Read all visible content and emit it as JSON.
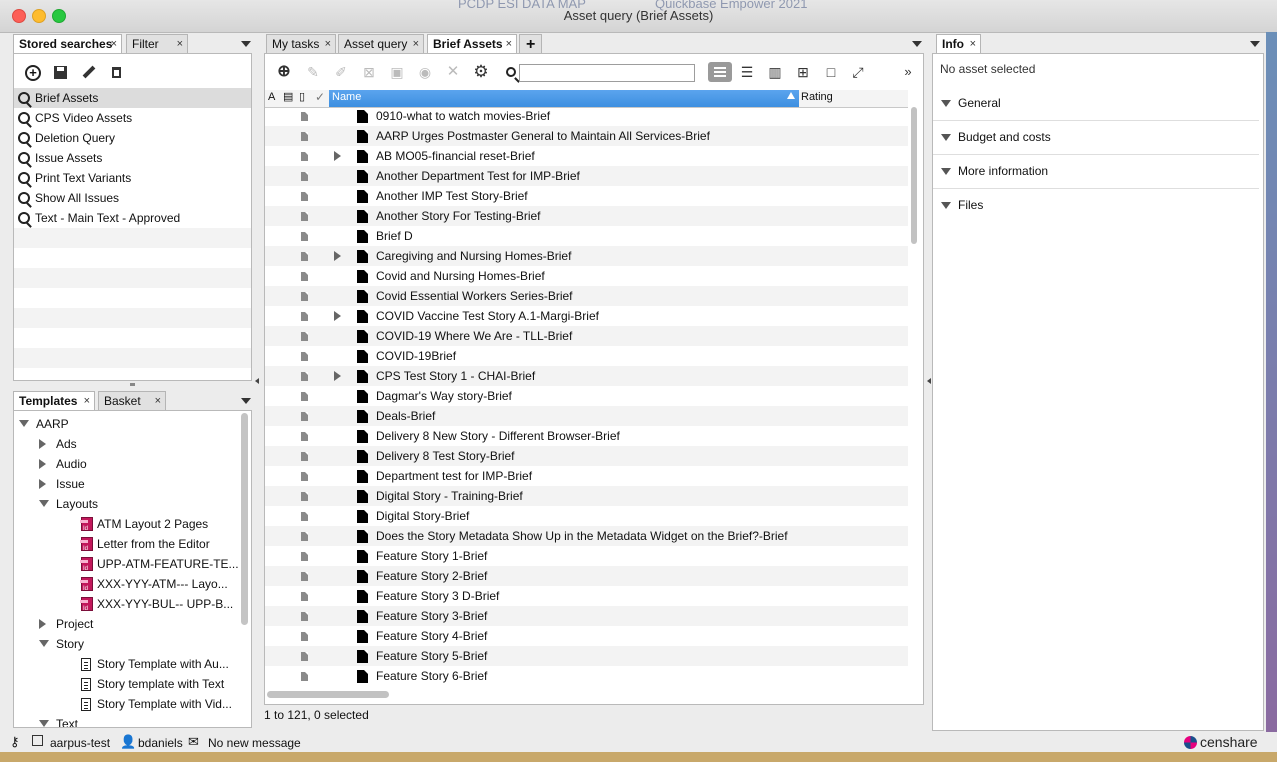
{
  "window": {
    "title": "Asset query (Brief Assets)",
    "background_texts": [
      "PCDP ESI DATA MAP",
      "Quickbase Empower 2021"
    ]
  },
  "colors": {
    "selection_blue": "#3d8fe0",
    "brand_censhare": "#1a4f8c"
  },
  "stored_searches": {
    "tabs": [
      {
        "label": "Stored searches",
        "close": "×"
      },
      {
        "label": "Filter",
        "close": "×"
      }
    ],
    "toolbar_icons": [
      "plus-circle-icon",
      "save-icon",
      "pencil-icon",
      "trash-icon"
    ],
    "items": [
      {
        "label": "Brief Assets",
        "selected": true
      },
      {
        "label": "CPS Video Assets"
      },
      {
        "label": "Deletion Query"
      },
      {
        "label": "Issue Assets"
      },
      {
        "label": "Print Text Variants"
      },
      {
        "label": "Show All Issues"
      },
      {
        "label": "Text - Main Text - Approved"
      }
    ]
  },
  "templates": {
    "tabs": [
      {
        "label": "Templates",
        "close": "×"
      },
      {
        "label": "Basket",
        "close": "×"
      }
    ],
    "tree": [
      {
        "label": "AARP",
        "level": 0,
        "state": "open"
      },
      {
        "label": "Ads",
        "level": 1,
        "state": "closed"
      },
      {
        "label": "Audio",
        "level": 1,
        "state": "closed"
      },
      {
        "label": "Issue",
        "level": 1,
        "state": "closed"
      },
      {
        "label": "Layouts",
        "level": 1,
        "state": "open"
      },
      {
        "label": "ATM Layout 2 Pages",
        "level": 2,
        "icon": "indesign-icon"
      },
      {
        "label": "Letter from the Editor",
        "level": 2,
        "icon": "indesign-icon"
      },
      {
        "label": "UPP-ATM-FEATURE-TE...",
        "level": 2,
        "icon": "indesign-icon"
      },
      {
        "label": "XXX-YYY-ATM--- Layo...",
        "level": 2,
        "icon": "indesign-icon"
      },
      {
        "label": "XXX-YYY-BUL-- UPP-B...",
        "level": 2,
        "icon": "indesign-icon"
      },
      {
        "label": "Project",
        "level": 1,
        "state": "closed"
      },
      {
        "label": "Story",
        "level": 1,
        "state": "open"
      },
      {
        "label": "Story Template with Au...",
        "level": 2,
        "icon": "text-doc-icon"
      },
      {
        "label": "Story template with Text",
        "level": 2,
        "icon": "text-doc-icon"
      },
      {
        "label": "Story Template with Vid...",
        "level": 2,
        "icon": "text-doc-icon"
      },
      {
        "label": "Text",
        "level": 1,
        "state": "open"
      }
    ]
  },
  "main": {
    "tabs": [
      {
        "label": "My tasks",
        "close": "×"
      },
      {
        "label": "Asset query",
        "close": "×"
      },
      {
        "label": "Brief Assets",
        "close": "×",
        "active": true
      }
    ],
    "add_tab": "+",
    "search": {
      "value": "",
      "placeholder": ""
    },
    "overflow": "»",
    "columns": {
      "name": "Name",
      "rating": "Rating",
      "icons": [
        "A",
        "▤",
        "▯",
        "✓"
      ]
    },
    "rows": [
      {
        "name": "0910-what to watch movies-Brief"
      },
      {
        "name": "AARP Urges Postmaster General to Maintain All Services-Brief"
      },
      {
        "name": "AB MO05-financial reset-Brief",
        "expandable": true
      },
      {
        "name": "Another Department Test for IMP-Brief"
      },
      {
        "name": "Another IMP Test Story-Brief"
      },
      {
        "name": "Another Story For Testing-Brief"
      },
      {
        "name": "Brief D"
      },
      {
        "name": "Caregiving and Nursing Homes-Brief",
        "expandable": true
      },
      {
        "name": "Covid and Nursing Homes-Brief"
      },
      {
        "name": "Covid Essential Workers Series-Brief"
      },
      {
        "name": "COVID Vaccine Test Story A.1-Margi-Brief",
        "expandable": true
      },
      {
        "name": "COVID-19 Where We Are - TLL-Brief"
      },
      {
        "name": "COVID-19Brief"
      },
      {
        "name": "CPS Test Story 1 - CHAI-Brief",
        "expandable": true
      },
      {
        "name": "Dagmar's Way story-Brief"
      },
      {
        "name": "Deals-Brief"
      },
      {
        "name": "Delivery 8 New Story - Different Browser-Brief"
      },
      {
        "name": "Delivery 8 Test Story-Brief"
      },
      {
        "name": "Department test for IMP-Brief"
      },
      {
        "name": "Digital Story - Training-Brief"
      },
      {
        "name": "Digital Story-Brief"
      },
      {
        "name": "Does the Story Metadata Show Up in the Metadata Widget on the Brief?-Brief"
      },
      {
        "name": "Feature Story 1-Brief"
      },
      {
        "name": "Feature Story 2-Brief"
      },
      {
        "name": "Feature Story 3 D-Brief"
      },
      {
        "name": "Feature Story 3-Brief"
      },
      {
        "name": "Feature Story 4-Brief"
      },
      {
        "name": "Feature Story 5-Brief"
      },
      {
        "name": "Feature Story 6-Brief"
      }
    ],
    "status": "1 to 121, 0 selected"
  },
  "info": {
    "tab": {
      "label": "Info",
      "close": "×"
    },
    "empty": "No asset selected",
    "sections": [
      "General",
      "Budget and costs",
      "More information",
      "Files"
    ]
  },
  "statusbar": {
    "server": "aarpus-test",
    "user": "bdaniels",
    "messages": "No new message",
    "brand": "censhare"
  }
}
